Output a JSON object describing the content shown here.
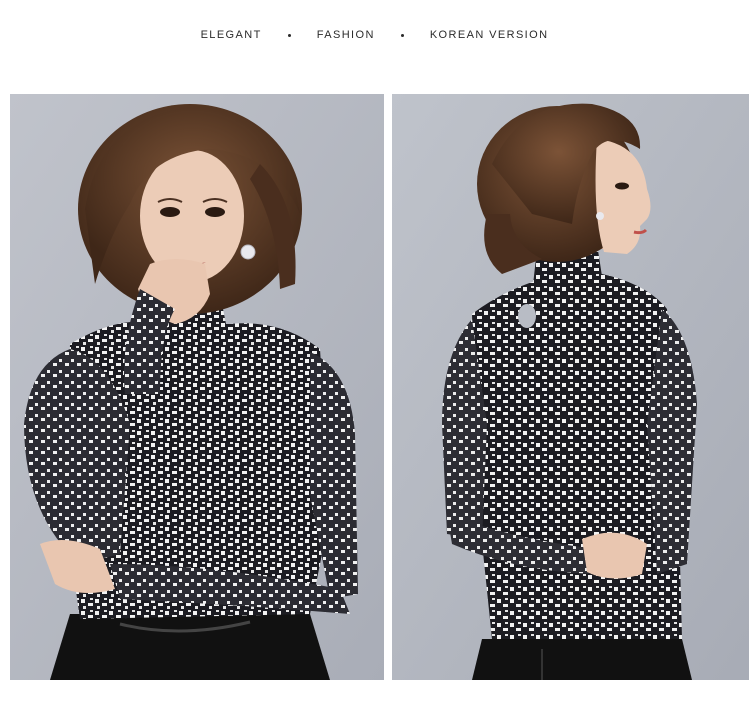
{
  "tagline": {
    "items": [
      "ELEGANT",
      "FASHION",
      "KOREAN VERSION"
    ]
  },
  "photos": [
    {
      "view": "front",
      "subject": "model-front-view"
    },
    {
      "view": "back",
      "subject": "model-back-view"
    }
  ],
  "colors": {
    "background": "#ffffff",
    "backdrop": "#b4b8c1",
    "hair": "#5a3a26",
    "skin": "#e9c6b0",
    "top": "#1c1c22",
    "top_pattern": "#f2f2f2",
    "skirt": "#111111"
  }
}
